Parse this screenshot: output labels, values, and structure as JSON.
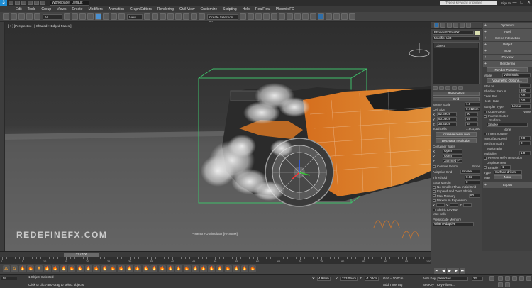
{
  "titlebar": {
    "logo": "3",
    "workspace": "Workspace: Default",
    "search_placeholder": "Type a keyword or phrase",
    "signin": "Sign In",
    "win_min": "—",
    "win_max": "□",
    "win_close": "✕"
  },
  "menu": [
    "Edit",
    "Tools",
    "Group",
    "Views",
    "Create",
    "Modifiers",
    "Animation",
    "Graph Editors",
    "Rendering",
    "Civil View",
    "Customize",
    "Scripting",
    "Help",
    "RealFlow",
    "Phoenix FD"
  ],
  "mainbar": {
    "filter": "All",
    "ref_coord": "View",
    "selection_set": "Create Selection Se"
  },
  "viewport": {
    "label": "[ + ] [Perspective ] [ Shaded + Edged Faces ]",
    "watermark": "REDEFINEFX.COM",
    "caption": "Phoenix FD Simulator [PHXSIM]"
  },
  "command_panel": {
    "object_name": "PhoenixFDFire001",
    "modifier_list": "Modifier List",
    "stack_item": "Object",
    "rollout_params": "Parameters",
    "rollout_grid": "Grid",
    "scene_scale_lbl": "Scene Scale",
    "scene_scale_val": "1.0",
    "cell_size_lbl": "Cell Size",
    "cell_size_val": "0.7126m",
    "size_rows": [
      {
        "axis": "X",
        "m": "52.39cm",
        "n": "90"
      },
      {
        "axis": "Y",
        "m": "90.03cm",
        "n": "89"
      },
      {
        "axis": "Z",
        "m": "35.44cm",
        "n": "64"
      }
    ],
    "total_cells_lbl": "Total cells",
    "total_cells_val": "1.801,350",
    "increase_res": "Increase resolution",
    "decrease_res": "Decrease resolution",
    "container_walls": "Container Walls",
    "walls": [
      {
        "axis": "X",
        "value": "Open"
      },
      {
        "axis": "Y",
        "value": "Open"
      },
      {
        "axis": "Z",
        "value": "Jammed (-)"
      }
    ],
    "confine_geom": "Confine Geom",
    "confine_none": "None",
    "adaptive_grid_lbl": "Adaptive Grid",
    "adaptive_grid_val": "Smoke",
    "threshold_lbl": "Threshold",
    "threshold_val": "0.02",
    "extra_margin_lbl": "Extra Margin",
    "extra_margin_val": "0",
    "no_smaller": "No Smaller Than Initial Grid",
    "expand_dont_shrink": "Expand and Don't Shrink",
    "max_memory_lbl": "Max Memory",
    "max_memory_val": "80",
    "max_expansion": "Maximum Expansion",
    "x_lbl": "X",
    "y_lbl": "Y",
    "z_lbl": "Z",
    "shrink_to_view": "Shrink to View",
    "max_cells": "Max cells",
    "preallocate": "Preallocate Memory",
    "preallocate_val": "When Adaptive"
  },
  "right_panel": {
    "heads": [
      "Dynamics",
      "Fuel",
      "Scene Interaction",
      "Output",
      "Input",
      "Preview",
      "Rendering"
    ],
    "render_presets": "Render Presets...",
    "mode_lbl": "Mode",
    "mode_val": "Volumetric",
    "volumetric_options": "Volumetric Options...",
    "step_lbl": "Step %",
    "step_val": "",
    "shadow_step_lbl": "Shadow Step %",
    "shadow_step_val": "200",
    "fade_out_lbl": "Fade Out",
    "fade_out_val": "0.0",
    "heat_haze_lbl": "Heat Haze",
    "heat_haze_val": "0.0",
    "sampler_lbl": "Sampler Type",
    "sampler_val": "Linear",
    "cutter_geom": "Cutter Geom",
    "cutter_none": "None",
    "inverse_cutter": "Inverse Cutter",
    "surface": "Surface",
    "surface_val": "Smoke",
    "none_btn": "None",
    "invert_volume": "Invert Volume",
    "isosurface_lbl": "Isosurface Level",
    "isosurface_val": "0.0",
    "mesh_smooth_lbl": "Mesh Smooth",
    "mesh_smooth_val": "0",
    "motion_blur": "Motion Blur",
    "multiplier_lbl": "Multiplier",
    "multiplier_val": "1.0",
    "prevent_self": "Prevent self-intersection",
    "displacement": "Displacement",
    "enable_lbl": "Enable",
    "enable_val": "1",
    "type_lbl": "Type",
    "type_val": "Surface driven",
    "map_lbl": "Map",
    "map_val": "None",
    "export": "Export"
  },
  "timeline": {
    "frame": "22 / 100",
    "ticks": [
      "0",
      "5",
      "10",
      "15",
      "20",
      "25",
      "30",
      "35",
      "40",
      "45",
      "50",
      "55",
      "60",
      "65",
      "70",
      "75",
      "80",
      "85",
      "90",
      "95",
      "100"
    ]
  },
  "fx_icons": [
    "🜂",
    "🜂",
    "🔥",
    "🔥",
    "✱",
    "🔥",
    "🔥",
    "🔥",
    "🔥",
    "🔥",
    "🔥",
    "🔥",
    "🔥",
    "🔥",
    "🔥",
    "🔥",
    "🔥",
    "🔥",
    "🔥",
    "🔥",
    "🔥",
    "🔥",
    "🔥",
    "🔥",
    "🔥",
    "🔥",
    "🔥",
    "🔥",
    "🔥",
    "🔥",
    "🔥"
  ],
  "status": {
    "maxscript": "M...",
    "selected": "1 Object Selected",
    "prompt": "Click or click-and-drag to select objects",
    "x_val": "4.98cm",
    "y_val": "223.094m",
    "z_val": "-1.08cm",
    "grid": "Grid = 10.0cm",
    "add_time_tag": "Add Time Tag",
    "auto_key": "Auto Key",
    "selected_dropdown": "Selected",
    "set_key": "Set Key",
    "key_filters": "Key Filters...",
    "frame_field": "22"
  },
  "colors": {
    "accent": "#1e8dd4",
    "orange": "#f08a24",
    "grid_green": "#3fbf6a"
  }
}
